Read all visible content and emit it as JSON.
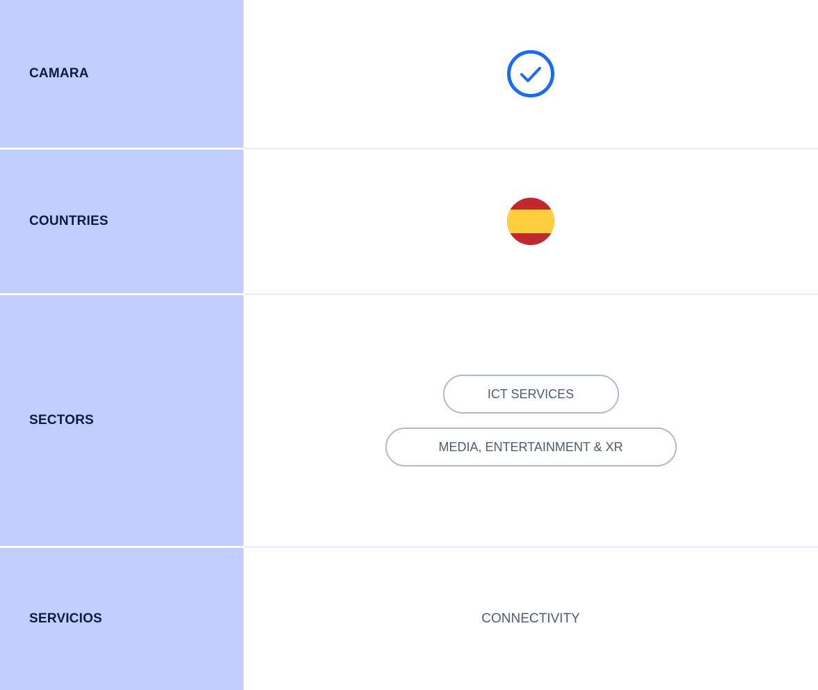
{
  "rows": [
    {
      "label": "CAMARA",
      "value_icon": "check-circle-icon",
      "value_checked": true
    },
    {
      "label": "COUNTRIES",
      "value_icon": "spain-flag-icon"
    },
    {
      "label": "SECTORS",
      "tags": [
        "ICT SERVICES",
        "MEDIA, ENTERTAINMENT & XR"
      ]
    },
    {
      "label": "SERVICIOS",
      "value": "CONNECTIVITY"
    }
  ],
  "colors": {
    "label_bg": "#c2cdff",
    "label_text": "#0d1b3e",
    "check_blue": "#1a6bf2",
    "flag_red": "#c0282d",
    "flag_yellow": "#ffcf3e",
    "pill_border": "#b4b9c6",
    "value_text": "#515a70"
  }
}
